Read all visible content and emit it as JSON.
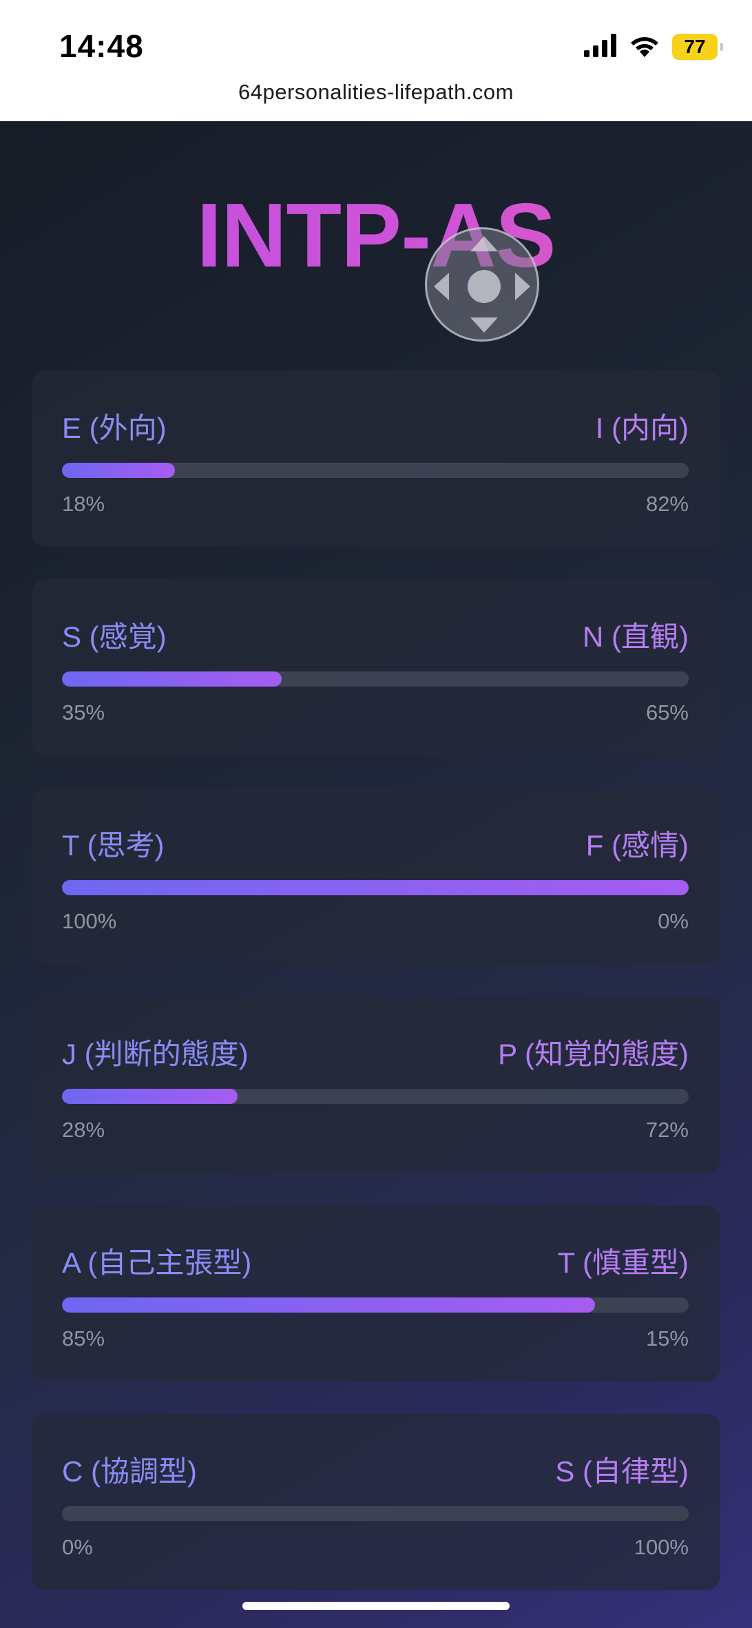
{
  "status_bar": {
    "time": "14:48",
    "battery": "77",
    "icons": [
      "cellular-signal-icon",
      "wifi-icon",
      "battery-icon"
    ]
  },
  "browser": {
    "url": "64personalities-lifepath.com"
  },
  "result": {
    "type_code": "INTP-AS"
  },
  "colors": {
    "title_gradient": [
      "#c04ee0",
      "#e25bb2"
    ],
    "bar_gradient": [
      "#6e67f2",
      "#a65cf1"
    ],
    "left_label": "#8a8cf5",
    "right_label": "#b57ef2",
    "track": "#3b4352"
  },
  "dimensions": [
    {
      "left_label": "E (外向)",
      "right_label": "I (内向)",
      "left_pct": "18%",
      "right_pct": "82%",
      "fill_fraction": 0.18
    },
    {
      "left_label": "S (感覚)",
      "right_label": "N (直観)",
      "left_pct": "35%",
      "right_pct": "65%",
      "fill_fraction": 0.35
    },
    {
      "left_label": "T (思考)",
      "right_label": "F (感情)",
      "left_pct": "100%",
      "right_pct": "0%",
      "fill_fraction": 1.0
    },
    {
      "left_label": "J (判断的態度)",
      "right_label": "P (知覚的態度)",
      "left_pct": "28%",
      "right_pct": "72%",
      "fill_fraction": 0.28
    },
    {
      "left_label": "A (自己主張型)",
      "right_label": "T (慎重型)",
      "left_pct": "85%",
      "right_pct": "15%",
      "fill_fraction": 0.85
    },
    {
      "left_label": "C (協調型)",
      "right_label": "S (自律型)",
      "left_pct": "0%",
      "right_pct": "100%",
      "fill_fraction": 0.0
    }
  ]
}
